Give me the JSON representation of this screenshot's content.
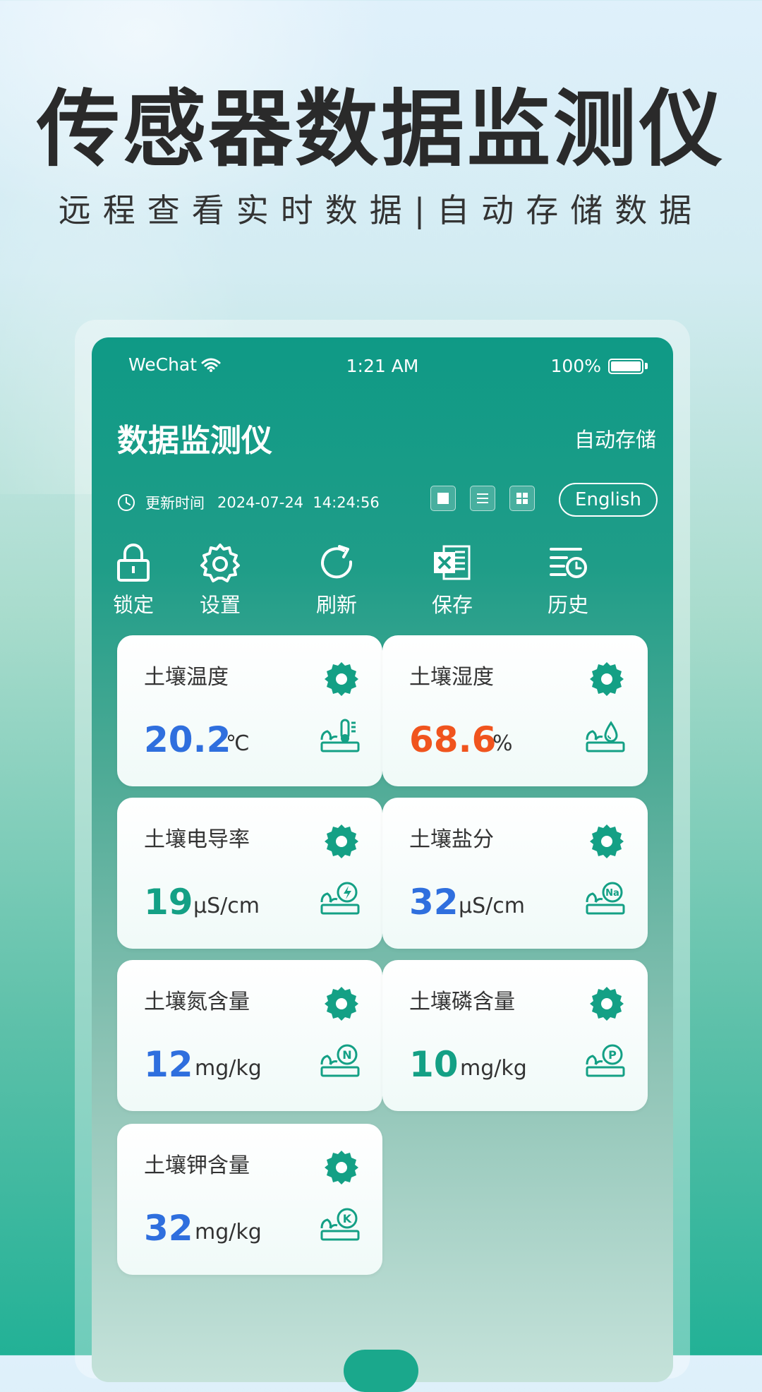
{
  "hero": {
    "title": "传感器数据监测仪",
    "subtitle": "远程查看实时数据|自动存储数据"
  },
  "status_bar": {
    "carrier": "WeChat",
    "time": "1:21 AM",
    "battery": "100%"
  },
  "header": {
    "title": "数据监测仪",
    "auto_save": "自动存储"
  },
  "info": {
    "update_label": "更新时间",
    "update_time": "2024-07-24  14:24:56",
    "language_button": "English"
  },
  "toolbar": {
    "items": [
      {
        "label": "锁定",
        "icon": "lock-icon"
      },
      {
        "label": "设置",
        "icon": "gear-icon"
      },
      {
        "label": "刷新",
        "icon": "refresh-icon"
      },
      {
        "label": "保存",
        "icon": "excel-icon"
      },
      {
        "label": "历史",
        "icon": "history-icon"
      }
    ]
  },
  "sensors": [
    {
      "title": "土壤温度",
      "value": "20.2",
      "unit": "℃",
      "value_color": "#2f6fde",
      "icon": "soil-thermometer-icon"
    },
    {
      "title": "土壤湿度",
      "value": "68.6",
      "unit": "%",
      "value_color": "#f0541e",
      "icon": "soil-droplet-icon"
    },
    {
      "title": "土壤电导率",
      "value": "19",
      "unit": "μS/cm",
      "value_color": "#14a085",
      "icon": "soil-lightning-icon"
    },
    {
      "title": "土壤盐分",
      "value": "32",
      "unit": "μS/cm",
      "value_color": "#2f6fde",
      "icon": "soil-na-icon",
      "icon_letter": "Na"
    },
    {
      "title": "土壤氮含量",
      "value": "12",
      "unit": "mg/kg",
      "value_color": "#2f6fde",
      "icon": "soil-n-icon",
      "icon_letter": "N"
    },
    {
      "title": "土壤磷含量",
      "value": "10",
      "unit": "mg/kg",
      "value_color": "#14a085",
      "icon": "soil-p-icon",
      "icon_letter": "P"
    },
    {
      "title": "土壤钾含量",
      "value": "32",
      "unit": "mg/kg",
      "value_color": "#2f6fde",
      "icon": "soil-k-icon",
      "icon_letter": "K"
    }
  ],
  "colors": {
    "accent": "#14a085",
    "header_green": "#0f9a86"
  }
}
